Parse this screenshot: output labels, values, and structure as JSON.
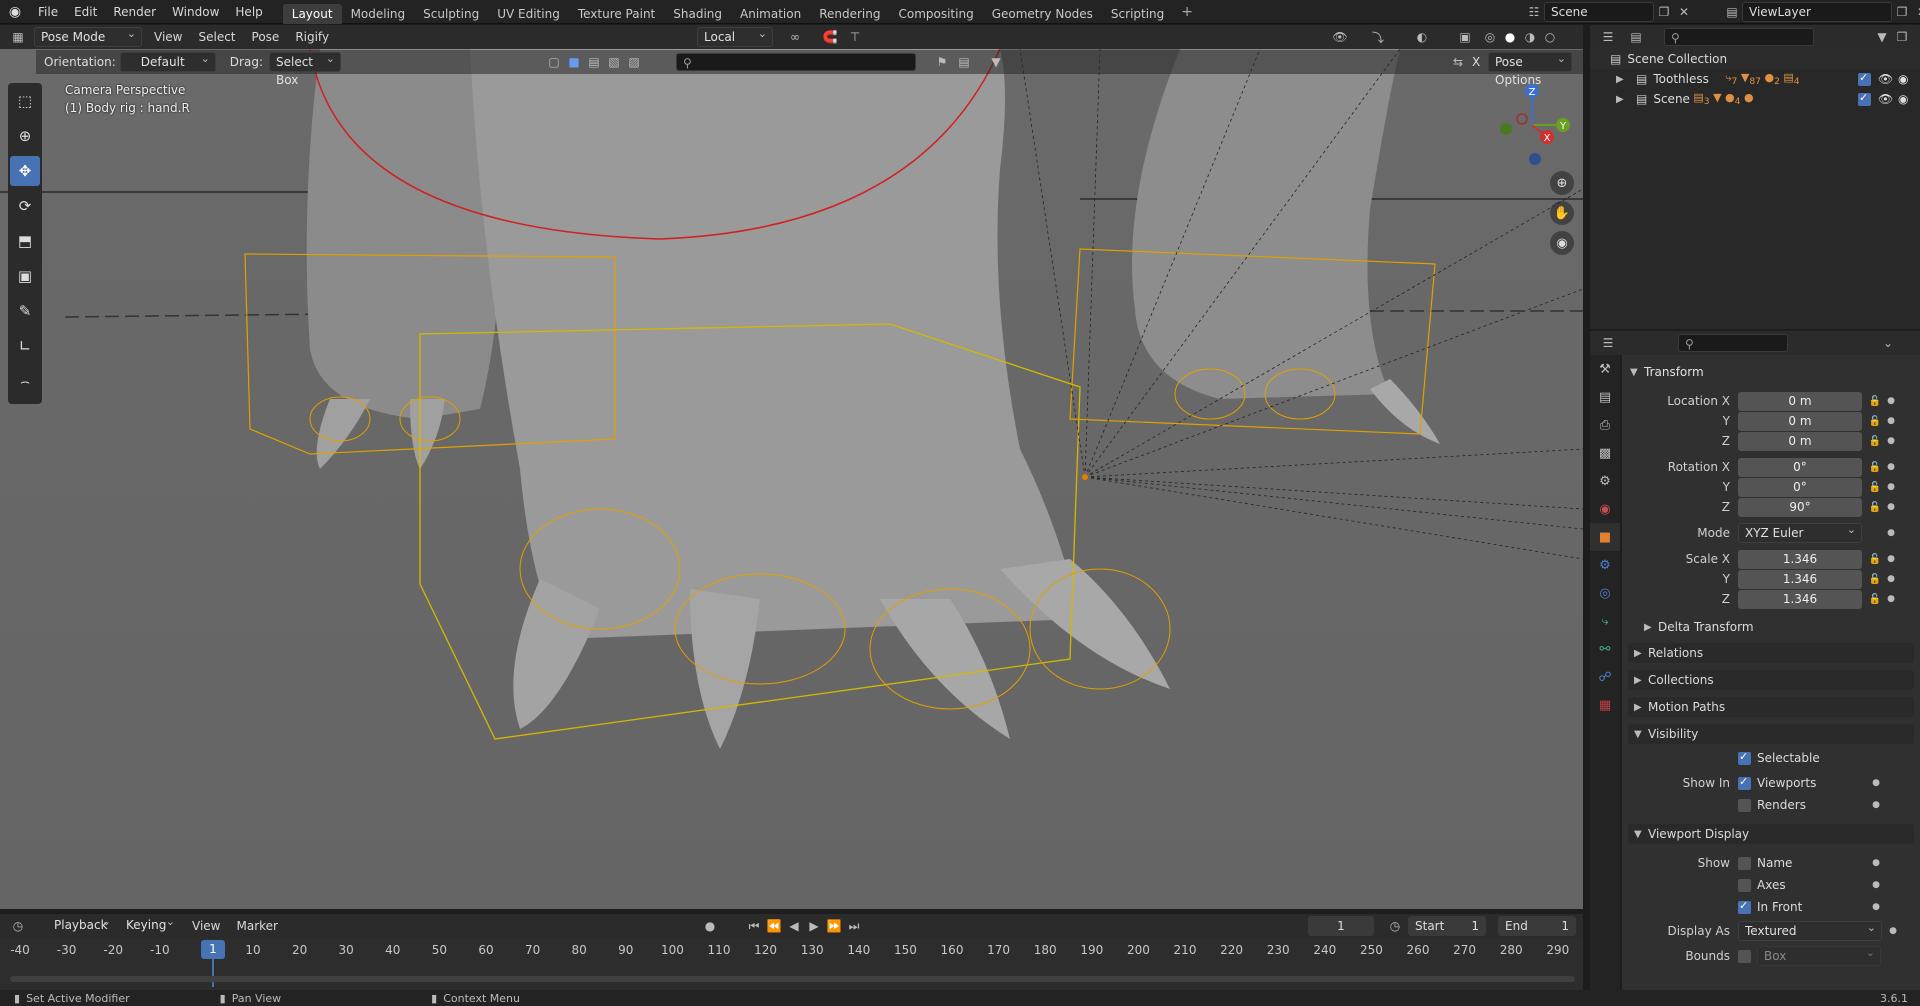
{
  "topbar": {
    "menus": [
      "File",
      "Edit",
      "Render",
      "Window",
      "Help"
    ],
    "workspaces": [
      "Layout",
      "Modeling",
      "Sculpting",
      "UV Editing",
      "Texture Paint",
      "Shading",
      "Animation",
      "Rendering",
      "Compositing",
      "Geometry Nodes",
      "Scripting"
    ],
    "active_workspace": "Layout",
    "scene": "Scene",
    "view_layer": "ViewLayer"
  },
  "viewport_header": {
    "mode": "Pose Mode",
    "menus": [
      "View",
      "Select",
      "Pose",
      "Rigify"
    ],
    "transform_orientation": "Local"
  },
  "tool_header": {
    "orientation_label": "Orientation:",
    "orientation_value": "Default",
    "drag_label": "Drag:",
    "drag_value": "Select Box",
    "pose_options": "Pose Options"
  },
  "viewport": {
    "view_name": "Camera Perspective",
    "active_info": "(1) Body rig : hand.R",
    "gizmo_axes": {
      "x": "X",
      "y": "Y",
      "z": "Z"
    }
  },
  "timeline": {
    "menus": [
      "Playback",
      "Keying",
      "View",
      "Marker"
    ],
    "current_frame": "1",
    "start_label": "Start",
    "start": "1",
    "end_label": "End",
    "end": "1",
    "ticks": [
      "-40",
      "-30",
      "-20",
      "-10",
      "1",
      "10",
      "20",
      "30",
      "40",
      "50",
      "60",
      "70",
      "80",
      "90",
      "100",
      "110",
      "120",
      "130",
      "140",
      "150",
      "160",
      "170",
      "180",
      "190",
      "200",
      "210",
      "220",
      "230",
      "240",
      "250",
      "260",
      "270",
      "280",
      "290"
    ],
    "playhead": "1"
  },
  "statusbar": {
    "items": [
      "Set Active Modifier",
      "Pan View",
      "Context Menu"
    ],
    "version": "3.6.1"
  },
  "outliner": {
    "root": "Scene Collection",
    "items": [
      {
        "name": "Toothless",
        "counts": [
          "7",
          "87",
          "2",
          "4"
        ]
      },
      {
        "name": "Scene",
        "counts": [
          "3",
          "4"
        ]
      }
    ]
  },
  "properties": {
    "transform_title": "Transform",
    "location": {
      "label": "Location X",
      "x": "0 m",
      "y": "0 m",
      "z": "0 m"
    },
    "rotation": {
      "label": "Rotation X",
      "x": "0°",
      "y": "0°",
      "z": "90°"
    },
    "mode_label": "Mode",
    "mode": "XYZ Euler",
    "scale": {
      "label": "Scale X",
      "x": "1.346",
      "y": "1.346",
      "z": "1.346"
    },
    "axis_y": "Y",
    "axis_z": "Z",
    "delta_transform": "Delta Transform",
    "collapsed": [
      "Relations",
      "Collections",
      "Motion Paths"
    ],
    "visibility_title": "Visibility",
    "selectable": "Selectable",
    "show_in_label": "Show In",
    "viewports": "Viewports",
    "renders": "Renders",
    "viewport_display_title": "Viewport Display",
    "show_label": "Show",
    "name": "Name",
    "axes": "Axes",
    "in_front": "In Front",
    "display_as_label": "Display As",
    "display_as": "Textured",
    "bounds_label": "Bounds",
    "bounds_value": "Box"
  },
  "colors": {
    "accent": "#4772b3",
    "bone_outline": "#e0a000",
    "selected_box": "#d4b800",
    "red_curve": "#d02020"
  }
}
